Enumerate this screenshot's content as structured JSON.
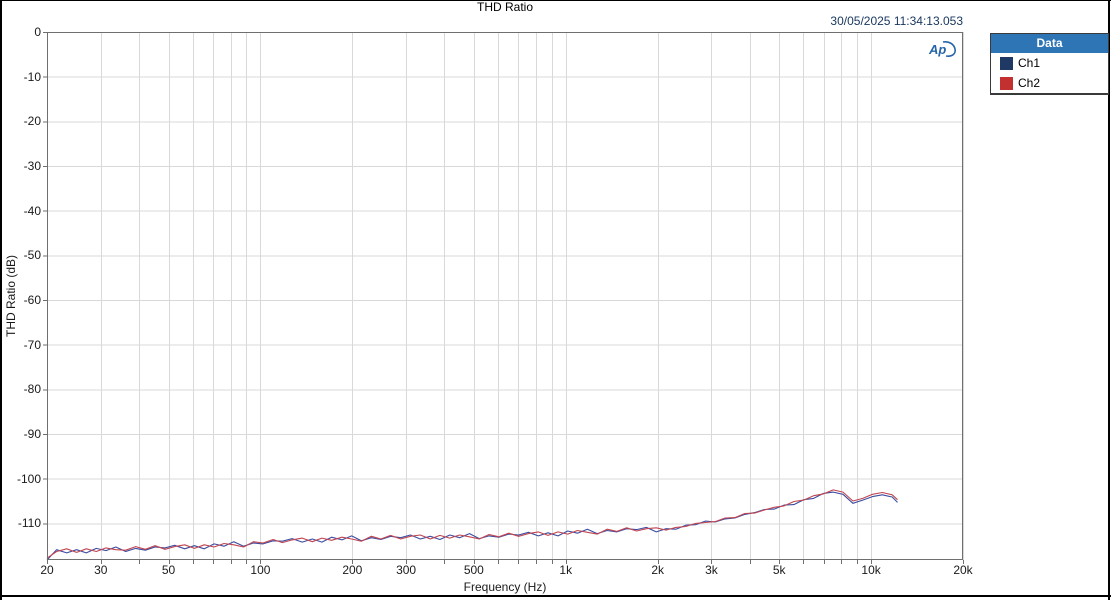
{
  "title": "THD Ratio",
  "timestamp": "30/05/2025 11:34:13.053",
  "logo_text": "Ap",
  "legend": {
    "header": "Data",
    "items": [
      {
        "label": "Ch1",
        "swatch_color": "#1f3864"
      },
      {
        "label": "Ch2",
        "swatch_color": "#c2312f"
      }
    ]
  },
  "colors": {
    "grid": "#d9d9d9",
    "plot_border": "#6f6f6f",
    "tick": "#6f6f6f",
    "timestamp": "#17365d",
    "legend_header_bg": "#2e75b5",
    "ch1_line": "#3c4da0",
    "ch2_line": "#c04651",
    "logo_blue": "#2565a8"
  },
  "chart_data": {
    "type": "line",
    "title": "THD Ratio",
    "xlabel": "Frequency (Hz)",
    "ylabel": "THD Ratio (dB)",
    "x_scale": "log",
    "xlim": [
      20,
      20000
    ],
    "ylim": [
      -118.2,
      0
    ],
    "grid": true,
    "legend_position": "top-right-panel",
    "x_tick_labels": [
      {
        "f": 20,
        "label": "20"
      },
      {
        "f": 30,
        "label": "30"
      },
      {
        "f": 50,
        "label": "50"
      },
      {
        "f": 100,
        "label": "100"
      },
      {
        "f": 200,
        "label": "200"
      },
      {
        "f": 300,
        "label": "300"
      },
      {
        "f": 500,
        "label": "500"
      },
      {
        "f": 1000,
        "label": "1k"
      },
      {
        "f": 2000,
        "label": "2k"
      },
      {
        "f": 3000,
        "label": "3k"
      },
      {
        "f": 5000,
        "label": "5k"
      },
      {
        "f": 10000,
        "label": "10k"
      },
      {
        "f": 20000,
        "label": "20k"
      }
    ],
    "y_tick_labels": [
      {
        "v": 0,
        "label": "0"
      },
      {
        "v": -10,
        "label": "-10"
      },
      {
        "v": -20,
        "label": "-20"
      },
      {
        "v": -30,
        "label": "-30"
      },
      {
        "v": -40,
        "label": "-40"
      },
      {
        "v": -50,
        "label": "-50"
      },
      {
        "v": -60,
        "label": "-60"
      },
      {
        "v": -70,
        "label": "-70"
      },
      {
        "v": -80,
        "label": "-80"
      },
      {
        "v": -90,
        "label": "-90"
      },
      {
        "v": -100,
        "label": "-100"
      },
      {
        "v": -110,
        "label": "-110"
      }
    ],
    "freqs": [
      20,
      21.5,
      23.2,
      25,
      26.9,
      29,
      31.2,
      33.6,
      36.2,
      39,
      42,
      45.2,
      48.7,
      52.4,
      56.5,
      60.8,
      65.5,
      70.5,
      76,
      81.8,
      88.1,
      94.9,
      102,
      110,
      118,
      127,
      137,
      148,
      159,
      171,
      185,
      199,
      214,
      231,
      248,
      267,
      288,
      310,
      334,
      360,
      387,
      417,
      449,
      484,
      521,
      561,
      604,
      651,
      701,
      755,
      813,
      875,
      943,
      1015,
      1093,
      1177,
      1268,
      1366,
      1471,
      1584,
      1706,
      1837,
      1979,
      2131,
      2295,
      2472,
      2662,
      2867,
      3087,
      3325,
      3581,
      3857,
      4153,
      4473,
      4817,
      5188,
      5587,
      6017,
      6480,
      6978,
      7515,
      8094,
      8717,
      9388,
      10110,
      10888,
      11726,
      12200
    ],
    "series": [
      {
        "name": "Ch1",
        "color": "#3c4da0",
        "values": [
          -118.2,
          -115.9,
          -116.6,
          -115.9,
          -116.6,
          -115.6,
          -116.1,
          -115.3,
          -116.3,
          -115.6,
          -116.0,
          -115.3,
          -115.5,
          -114.9,
          -115.7,
          -115.0,
          -115.7,
          -114.6,
          -115.1,
          -114.1,
          -115.1,
          -114.4,
          -114.6,
          -113.9,
          -114.0,
          -113.4,
          -114.2,
          -113.5,
          -114.2,
          -113.1,
          -113.7,
          -112.8,
          -113.9,
          -113.2,
          -113.6,
          -112.9,
          -113.2,
          -112.6,
          -113.5,
          -112.9,
          -113.6,
          -112.6,
          -113.2,
          -112.3,
          -113.4,
          -112.8,
          -113.1,
          -112.4,
          -112.6,
          -112.0,
          -112.8,
          -112.1,
          -112.8,
          -111.7,
          -112.2,
          -111.3,
          -112.3,
          -111.6,
          -111.9,
          -111.2,
          -111.4,
          -110.9,
          -111.9,
          -111.2,
          -111.3,
          -110.4,
          -110.3,
          -109.5,
          -109.7,
          -109.0,
          -108.8,
          -108.0,
          -107.6,
          -106.9,
          -106.8,
          -105.9,
          -105.8,
          -104.7,
          -104.4,
          -103.3,
          -103.0,
          -103.5,
          -105.5,
          -104.8,
          -104.0,
          -103.6,
          -104.1,
          -105.3
        ]
      },
      {
        "name": "Ch2",
        "color": "#c04651",
        "values": [
          -117.8,
          -116.3,
          -115.7,
          -116.5,
          -115.7,
          -116.3,
          -115.5,
          -115.9,
          -116.0,
          -115.2,
          -115.8,
          -115.0,
          -115.8,
          -115.2,
          -114.8,
          -115.6,
          -114.8,
          -115.3,
          -114.5,
          -114.8,
          -115.3,
          -114.1,
          -114.4,
          -113.6,
          -114.3,
          -113.7,
          -113.3,
          -114.1,
          -113.3,
          -113.8,
          -113.1,
          -113.5,
          -114.0,
          -112.9,
          -113.5,
          -112.7,
          -113.5,
          -112.9,
          -112.6,
          -113.5,
          -112.7,
          -113.3,
          -112.6,
          -113.0,
          -113.5,
          -112.5,
          -113.0,
          -112.2,
          -112.9,
          -112.3,
          -111.9,
          -112.7,
          -111.9,
          -112.4,
          -111.6,
          -112.0,
          -112.4,
          -111.3,
          -111.8,
          -111.0,
          -111.7,
          -111.2,
          -111.0,
          -111.5,
          -110.9,
          -110.7,
          -110.0,
          -109.8,
          -109.6,
          -108.8,
          -108.7,
          -107.8,
          -107.7,
          -107.0,
          -106.4,
          -106.1,
          -105.1,
          -104.8,
          -103.8,
          -103.4,
          -102.5,
          -103.0,
          -105.0,
          -104.4,
          -103.5,
          -103.1,
          -103.6,
          -104.7
        ]
      }
    ]
  }
}
